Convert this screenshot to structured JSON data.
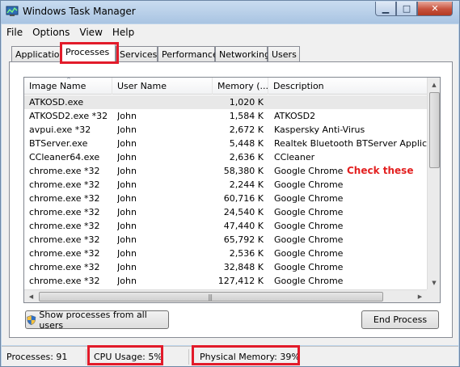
{
  "window": {
    "title": "Windows Task Manager"
  },
  "menu": [
    "File",
    "Options",
    "View",
    "Help"
  ],
  "tabs": [
    "Applications",
    "Processes",
    "Services",
    "Performance",
    "Networking",
    "Users"
  ],
  "columns": [
    "Image Name",
    "User Name",
    "Memory (...",
    "Description"
  ],
  "processes": [
    {
      "name": "ATKOSD.exe",
      "user": "",
      "memory": "1,020 K",
      "description": ""
    },
    {
      "name": "ATKOSD2.exe *32",
      "user": "John",
      "memory": "1,584 K",
      "description": "ATKOSD2"
    },
    {
      "name": "avpui.exe *32",
      "user": "John",
      "memory": "2,672 K",
      "description": "Kaspersky Anti-Virus"
    },
    {
      "name": "BTServer.exe",
      "user": "John",
      "memory": "5,448 K",
      "description": "Realtek Bluetooth BTServer Application"
    },
    {
      "name": "CCleaner64.exe",
      "user": "John",
      "memory": "2,636 K",
      "description": "CCleaner"
    },
    {
      "name": "chrome.exe *32",
      "user": "John",
      "memory": "58,380 K",
      "description": "Google Chrome"
    },
    {
      "name": "chrome.exe *32",
      "user": "John",
      "memory": "2,244 K",
      "description": "Google Chrome"
    },
    {
      "name": "chrome.exe *32",
      "user": "John",
      "memory": "60,716 K",
      "description": "Google Chrome"
    },
    {
      "name": "chrome.exe *32",
      "user": "John",
      "memory": "24,540 K",
      "description": "Google Chrome"
    },
    {
      "name": "chrome.exe *32",
      "user": "John",
      "memory": "47,440 K",
      "description": "Google Chrome"
    },
    {
      "name": "chrome.exe *32",
      "user": "John",
      "memory": "65,792 K",
      "description": "Google Chrome"
    },
    {
      "name": "chrome.exe *32",
      "user": "John",
      "memory": "2,536 K",
      "description": "Google Chrome"
    },
    {
      "name": "chrome.exe *32",
      "user": "John",
      "memory": "32,848 K",
      "description": "Google Chrome"
    },
    {
      "name": "chrome.exe *32",
      "user": "John",
      "memory": "127,412 K",
      "description": "Google Chrome"
    }
  ],
  "annotation": "Check these",
  "buttons": {
    "show_all": "Show processes from all users",
    "end_process": "End Process"
  },
  "status": {
    "processes": "Processes: 91",
    "cpu": "CPU Usage: 5%",
    "memory": "Physical Memory: 39%"
  },
  "highlight_color": "#e21b2a",
  "icons": {
    "app": "task-manager-icon",
    "uac": "uac-shield-icon"
  }
}
